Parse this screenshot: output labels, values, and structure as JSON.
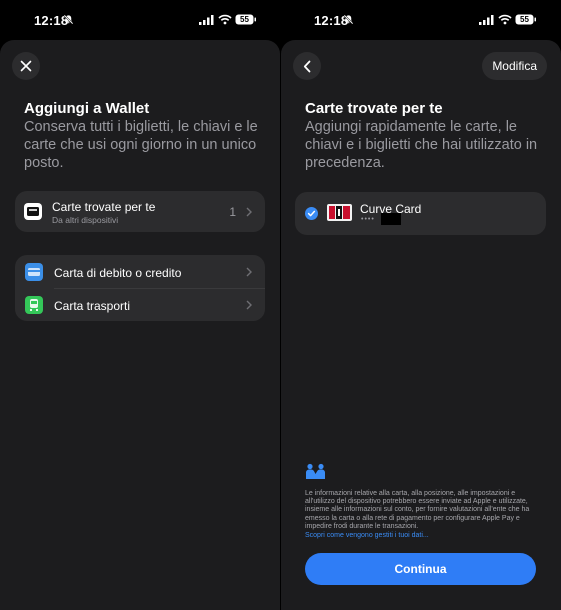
{
  "status": {
    "time": "12:18",
    "battery": "55"
  },
  "left": {
    "title": "Aggiungi a Wallet",
    "subtitle": "Conserva tutti i biglietti, le chiavi e le carte che usi ogni giorno in un unico posto.",
    "found_row": {
      "label": "Carte trovate per te",
      "sub": "Da altri dispositivi",
      "count": "1"
    },
    "options": [
      {
        "label": "Carta di debito o credito"
      },
      {
        "label": "Carta trasporti"
      }
    ]
  },
  "right": {
    "edit_label": "Modifica",
    "title": "Carte trovate per te",
    "subtitle": "Aggiungi rapidamente le carte, le chiavi e i biglietti che hai utilizzato in precedenza.",
    "card": {
      "name": "Curve Card",
      "masked": "••••"
    },
    "privacy_text": "Le informazioni relative alla carta, alla posizione, alle impostazioni e all'utilizzo del dispositivo potrebbero essere inviate ad Apple e utilizzate, insieme alle informazioni sul conto, per fornire valutazioni all'ente che ha emesso la carta o alla rete di pagamento per configurare Apple Pay e impedire frodi durante le transazioni.",
    "privacy_link": "Scopri come vengono gestiti i tuoi dati...",
    "continue_label": "Continua"
  }
}
